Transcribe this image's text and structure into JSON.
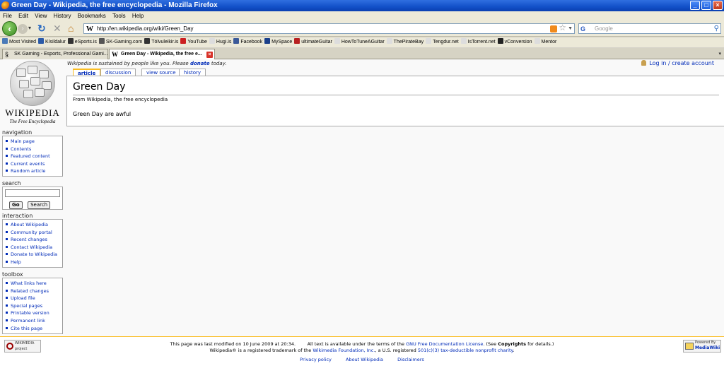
{
  "window": {
    "title": "Green Day - Wikipedia, the free encyclopedia - Mozilla Firefox"
  },
  "menu": [
    "File",
    "Edit",
    "View",
    "History",
    "Bookmarks",
    "Tools",
    "Help"
  ],
  "nav": {
    "url": "http://en.wikipedia.org/wiki/Green_Day",
    "search_placeholder": "Google"
  },
  "bookmarks": [
    {
      "label": "Most Visited",
      "color": "#4a7ab8"
    },
    {
      "label": "Kísildalur",
      "color": "#2b5aa8"
    },
    {
      "label": "eSports.is",
      "color": "#333333"
    },
    {
      "label": "SK-Gaming.com",
      "color": "#555555"
    },
    {
      "label": "Tölvuleikir.is",
      "color": "#333333"
    },
    {
      "label": "YouTube",
      "color": "#cc2020"
    },
    {
      "label": "Hugi.is",
      "color": "#dddddd"
    },
    {
      "label": "Facebook",
      "color": "#3b5998"
    },
    {
      "label": "MySpace",
      "color": "#1a3f8a"
    },
    {
      "label": "ultimateGuitar",
      "color": "#b82020"
    },
    {
      "label": "HowToTuneAGuitar",
      "color": "#dddddd"
    },
    {
      "label": "ThePirateBay",
      "color": "#dddddd"
    },
    {
      "label": "Tengdur.net",
      "color": "#dddddd"
    },
    {
      "label": "IsTorrent.net",
      "color": "#dddddd"
    },
    {
      "label": "vConversion",
      "color": "#222222"
    },
    {
      "label": "Mentor",
      "color": "#dddddd"
    }
  ],
  "tabs": [
    {
      "label": "SK Gaming - Esports, Professional Gami..."
    },
    {
      "label": "Green Day - Wikipedia, the free e..."
    }
  ],
  "wiki": {
    "notice_prefix": "Wikipedia is sustained by people like you. Please",
    "notice_link": "donate",
    "notice_suffix": "today.",
    "login": "Log in / create account",
    "logo_wordmark": "WIKIPEDIA",
    "logo_tagline": "The Free Encyclopedia",
    "page_tabs": {
      "article": "article",
      "discussion": "discussion",
      "view_source": "view source",
      "history": "history"
    },
    "heading": "Green Day",
    "site_sub": "From Wikipedia, the free encyclopedia",
    "body": "Green Day are awful"
  },
  "sidebar": {
    "navigation_title": "navigation",
    "navigation": [
      "Main page",
      "Contents",
      "Featured content",
      "Current events",
      "Random article"
    ],
    "search_title": "search",
    "go": "Go",
    "search": "Search",
    "interaction_title": "interaction",
    "interaction": [
      "About Wikipedia",
      "Community portal",
      "Recent changes",
      "Contact Wikipedia",
      "Donate to Wikipedia",
      "Help"
    ],
    "toolbox_title": "toolbox",
    "toolbox": [
      "What links here",
      "Related changes",
      "Upload file",
      "Special pages",
      "Printable version",
      "Permanent link",
      "Cite this page"
    ]
  },
  "footer": {
    "wmf_badge": "WIKIMEDIA project",
    "mw_badge_top": "Powered By",
    "mw_badge_name": "MediaWiki",
    "line1_a": "This page was last modified on 10 June 2009 at 20:34.",
    "line1_b": "All text is available under the terms of the",
    "line1_link": "GNU Free Documentation License",
    "line1_c": ". (See",
    "line1_copyrights": "Copyrights",
    "line1_d": "for details.)",
    "line2_a": "Wikipedia® is a registered trademark of the",
    "line2_link": "Wikimedia Foundation, Inc.",
    "line2_b": ", a U.S. registered",
    "line2_link2": "501(c)(3)",
    "line2_link3": "tax-deductible",
    "line2_link4": "nonprofit",
    "line2_link5": "charity",
    "line2_end": ".",
    "links": [
      "Privacy policy",
      "About Wikipedia",
      "Disclaimers"
    ]
  }
}
